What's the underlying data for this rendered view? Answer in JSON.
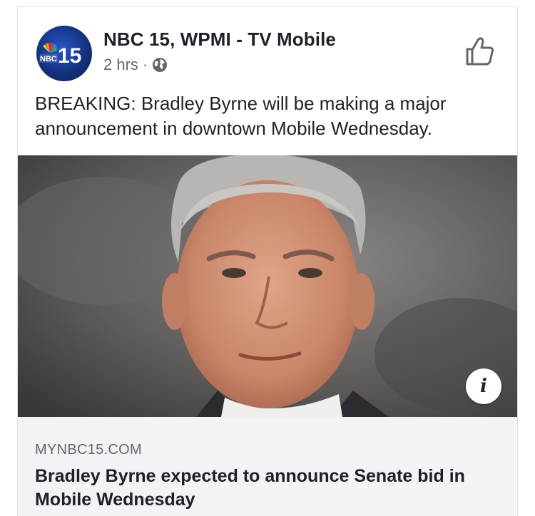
{
  "post": {
    "page_name": "NBC 15, WPMI - TV Mobile",
    "time": "2 hrs",
    "separator": "·",
    "privacy_icon": "globe-icon",
    "text": "BREAKING: Bradley Byrne will be making a major announcement in downtown Mobile Wednesday.",
    "avatar": {
      "logo_text": "NBC",
      "logo_number": "15"
    },
    "like_icon": "thumbs-up-icon"
  },
  "link_preview": {
    "domain": "MYNBC15.COM",
    "headline": "Bradley Byrne expected to announce Senate bid in Mobile Wednesday",
    "info_glyph": "i"
  },
  "colors": {
    "text_primary": "#1d2129",
    "text_secondary": "#606770",
    "link_box_bg": "#f2f3f5",
    "avatar_blue": "#14327f"
  }
}
